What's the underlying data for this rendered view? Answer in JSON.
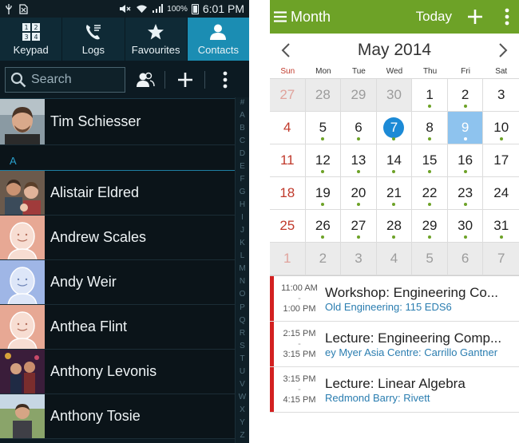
{
  "contacts_app": {
    "statusbar": {
      "battery": "100%",
      "time": "6:01 PM"
    },
    "tabs": [
      {
        "label": "Keypad",
        "icon": "keypad-icon",
        "active": false
      },
      {
        "label": "Logs",
        "icon": "phone-logs-icon",
        "active": false
      },
      {
        "label": "Favourites",
        "icon": "star-icon",
        "active": false
      },
      {
        "label": "Contacts",
        "icon": "person-icon",
        "active": true
      }
    ],
    "search": {
      "placeholder": "Search"
    },
    "contacts": [
      {
        "name": "Tim Schiesser",
        "section": "#"
      },
      {
        "name": "Alistair Eldred",
        "section": "A"
      },
      {
        "name": "Andrew Scales",
        "section": "A"
      },
      {
        "name": "Andy Weir",
        "section": "A"
      },
      {
        "name": "Anthea Flint",
        "section": "A"
      },
      {
        "name": "Anthony Levonis",
        "section": "A"
      },
      {
        "name": "Anthony Tosie",
        "section": "A"
      }
    ],
    "section_label": "A",
    "index_letters": [
      "#",
      "A",
      "B",
      "C",
      "D",
      "E",
      "F",
      "G",
      "H",
      "I",
      "J",
      "K",
      "L",
      "M",
      "N",
      "O",
      "P",
      "Q",
      "R",
      "S",
      "T",
      "U",
      "V",
      "W",
      "X",
      "Y",
      "Z"
    ],
    "colors": {
      "accent": "#1b8db3",
      "background": "#0c1a22"
    }
  },
  "calendar_app": {
    "actionbar": {
      "view_label": "Month",
      "today_label": "Today"
    },
    "month_title": "May 2014",
    "weekdays": [
      "Sun",
      "Mon",
      "Tue",
      "Wed",
      "Thu",
      "Fri",
      "Sat"
    ],
    "weeks": [
      [
        "27",
        "28",
        "29",
        "30",
        "1",
        "2",
        "3"
      ],
      [
        "4",
        "5",
        "6",
        "7",
        "8",
        "9",
        "10"
      ],
      [
        "11",
        "12",
        "13",
        "14",
        "15",
        "16",
        "17"
      ],
      [
        "18",
        "19",
        "20",
        "21",
        "22",
        "23",
        "24"
      ],
      [
        "25",
        "26",
        "27",
        "28",
        "29",
        "30",
        "31"
      ],
      [
        "1",
        "2",
        "3",
        "4",
        "5",
        "6",
        "7"
      ]
    ],
    "today": "7",
    "selected": "9",
    "events": [
      {
        "start": "11:00 AM",
        "end": "1:00 PM",
        "title": "Workshop: Engineering Co...",
        "location": "Old Engineering: 115 EDS6"
      },
      {
        "start": "2:15 PM",
        "end": "3:15 PM",
        "title": "Lecture: Engineering Comp...",
        "location": "ey Myer Asia Centre: Carrillo Gantner"
      },
      {
        "start": "3:15 PM",
        "end": "4:15 PM",
        "title": "Lecture: Linear Algebra",
        "location": "Redmond Barry: Rivett"
      }
    ],
    "colors": {
      "accent": "#6da227",
      "today": "#1c8ad6",
      "selected": "#8ec3ee",
      "event_bar": "#d32020"
    }
  }
}
